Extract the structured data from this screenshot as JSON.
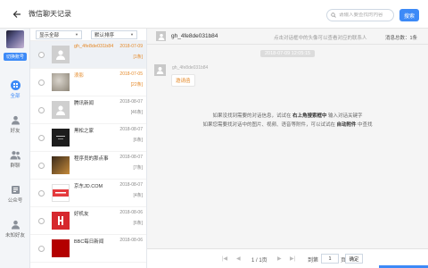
{
  "window": {
    "title": "微信聊天记录"
  },
  "search": {
    "placeholder": "请输入要查找的内容",
    "button_label": "搜索"
  },
  "sidebar": {
    "switch_label": "切换账号",
    "items": [
      {
        "label": "全部",
        "icon": "grid-icon",
        "active": true
      },
      {
        "label": "好友",
        "icon": "person-icon",
        "active": false
      },
      {
        "label": "群聊",
        "icon": "group-icon",
        "active": false
      },
      {
        "label": "公众号",
        "icon": "official-account-icon",
        "active": false
      },
      {
        "label": "未知好友",
        "icon": "unknown-person-icon",
        "active": false
      }
    ]
  },
  "list": {
    "filter_value": "显示全部",
    "sort_value": "默认排序",
    "conversations": [
      {
        "name": "gh_4fe8de031b84",
        "date": "2018-07-09",
        "count": "[1条]",
        "state": "selected"
      },
      {
        "name": "浪影",
        "date": "2018-07-05",
        "count": "[22条]",
        "state": "highlight"
      },
      {
        "name": "腾讯新闻",
        "date": "2018-08-07",
        "count": "[46条]",
        "state": ""
      },
      {
        "name": "黑松之家",
        "date": "2018-08-07",
        "count": "[6条]",
        "state": ""
      },
      {
        "name": "程序员的那点事",
        "date": "2018-08-07",
        "count": "[7条]",
        "state": ""
      },
      {
        "name": "京东JD.COM",
        "date": "2018-08-07",
        "count": "[4条]",
        "state": ""
      },
      {
        "name": "好机友",
        "date": "2018-08-06",
        "count": "[6条]",
        "state": ""
      },
      {
        "name": "BBC每日新闻",
        "date": "2018-08-06",
        "count": "",
        "state": ""
      }
    ]
  },
  "chat": {
    "contact_name": "gh_4fe8de031b84",
    "hint": "点击对话框中的头像可以查看对应的联系人",
    "total_label": "消息总数：1条",
    "date_divider": "2018-07-09 12:05:15",
    "message": {
      "sender": "gh_4fe8de031b84",
      "text": "邀请函"
    },
    "help_line1_pre": "如果没找到需要的对话信息，试试在 ",
    "help_line1_bold": "右上角搜索框中",
    "help_line1_post": " 输入对话关键字",
    "help_line2_pre": "如果您需要找对话中的图片、视频、语音等附件，可以试试在 ",
    "help_line2_bold": "自动附件",
    "help_line2_post": " 中查找"
  },
  "pager": {
    "first": "|◀",
    "prev": "◀",
    "page_info": "1 / 1页",
    "next": "▶",
    "last": "▶|",
    "goto_label": "到第",
    "goto_value": "1",
    "page_unit": "页",
    "confirm_label": "确定"
  },
  "colors": {
    "accent": "#3d8af7",
    "highlight": "#e58a2a"
  }
}
